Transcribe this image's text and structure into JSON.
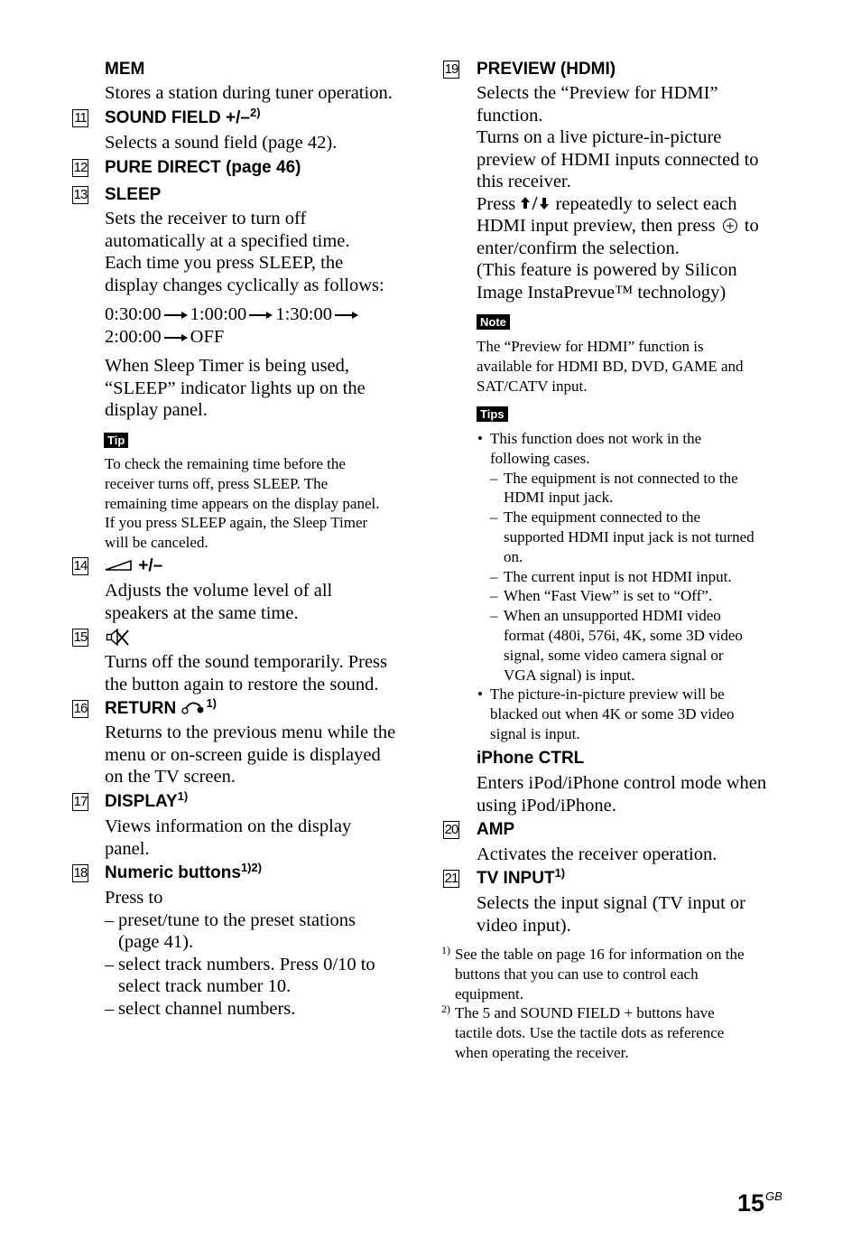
{
  "page": {
    "number": "15",
    "suffix": "GB"
  },
  "left": {
    "mem": {
      "title": "MEM",
      "desc": "Stores a station during tuner operation."
    },
    "item11": {
      "num": "11",
      "title": "SOUND FIELD +/–",
      "sup": "2)",
      "desc": "Selects a sound field (page 42)."
    },
    "item12": {
      "num": "12",
      "title": "PURE DIRECT (page 46)"
    },
    "item13": {
      "num": "13",
      "title": "SLEEP",
      "desc_lines": [
        "Sets the receiver to turn off",
        "automatically at a specified time.",
        "Each time you press SLEEP, the",
        "display changes cyclically as follows:"
      ],
      "cycle": [
        "0:30:00",
        "1:00:00",
        "1:30:00",
        "2:00:00",
        "OFF"
      ],
      "desc2_lines": [
        "When Sleep Timer is being used,",
        "“SLEEP” indicator lights up on the",
        "display panel."
      ],
      "tip_label": "Tip",
      "tip_lines": [
        "To check the remaining time before the",
        "receiver turns off, press SLEEP. The",
        "remaining time appears on the display panel.",
        "If you press SLEEP again, the Sleep Timer",
        "will be canceled."
      ]
    },
    "item14": {
      "num": "14",
      "title": "+/–",
      "icon": "volume-ramp-icon",
      "desc_lines": [
        "Adjusts the volume level of all",
        "speakers at the same time."
      ]
    },
    "item15": {
      "num": "15",
      "icon": "mute-icon",
      "desc_lines": [
        "Turns off the sound temporarily. Press",
        "the button again to restore the sound."
      ]
    },
    "item16": {
      "num": "16",
      "title": "RETURN",
      "icon": "return-icon",
      "sup": "1)",
      "desc_lines": [
        "Returns to the previous menu while the",
        "menu or on-screen guide is displayed",
        "on the TV screen."
      ]
    },
    "item17": {
      "num": "17",
      "title": "DISPLAY",
      "sup": "1)",
      "desc_lines": [
        "Views information on the display",
        "panel."
      ]
    },
    "item18": {
      "num": "18",
      "title": "Numeric buttons",
      "sup": "1)2)",
      "intro": "Press to",
      "list": [
        [
          "preset/tune to the preset stations",
          "(page 41)."
        ],
        [
          "select track numbers. Press 0/10 to",
          "select track number 10."
        ],
        [
          "select channel numbers."
        ]
      ]
    }
  },
  "right": {
    "item19": {
      "num": "19",
      "title": "PREVIEW (HDMI)",
      "desc_lines": [
        "Selects the “Preview for HDMI”",
        "function.",
        "Turns on a live picture-in-picture",
        "preview of HDMI inputs connected to",
        "this receiver."
      ],
      "press_prefix": "Press",
      "press_icons": "up-down-arrows-icon",
      "press_suffix": "repeatedly to select each",
      "press_line2_prefix": "HDMI input preview, then press",
      "press_line2_suffix": "to",
      "press_line3": "enter/confirm the selection.",
      "powered_lines": [
        "(This feature is powered by Silicon",
        "Image InstaPrevue™ technology)"
      ],
      "note_label": "Note",
      "note_lines": [
        "The “Preview for HDMI” function is",
        "available for HDMI BD, DVD, GAME and",
        "SAT/CATV input."
      ],
      "tips_label": "Tips",
      "tips": [
        {
          "lines": [
            "This function does not work in the",
            "following cases."
          ],
          "sub": [
            [
              "The equipment is not connected to the",
              "HDMI input jack."
            ],
            [
              "The equipment connected to the",
              "supported HDMI input jack is not turned",
              "on."
            ],
            [
              "The current input is not HDMI input."
            ],
            [
              "When “Fast View” is set to “Off”."
            ],
            [
              "When an unsupported HDMI video",
              "format (480i, 576i, 4K, some 3D video",
              "signal, some video camera signal or",
              "VGA signal) is input."
            ]
          ]
        },
        {
          "lines": [
            "The picture-in-picture preview will be",
            "blacked out when 4K or some 3D video",
            "signal is input."
          ]
        }
      ]
    },
    "iphone": {
      "title": "iPhone CTRL",
      "desc_lines": [
        "Enters iPod/iPhone control mode when",
        "using iPod/iPhone."
      ]
    },
    "item20": {
      "num": "20",
      "title": "AMP",
      "desc": "Activates the receiver operation."
    },
    "item21": {
      "num": "21",
      "title": "TV INPUT",
      "sup": "1)",
      "desc_lines": [
        "Selects the input signal (TV input or",
        "video input)."
      ]
    },
    "footnotes": [
      {
        "mark": "1)",
        "lines": [
          "See the table on page 16 for information on the",
          "buttons that you can use to control each",
          "equipment."
        ]
      },
      {
        "mark": "2)",
        "lines": [
          "The 5 and SOUND FIELD + buttons have",
          "tactile dots. Use the tactile dots as reference",
          "when operating the receiver."
        ]
      }
    ]
  }
}
